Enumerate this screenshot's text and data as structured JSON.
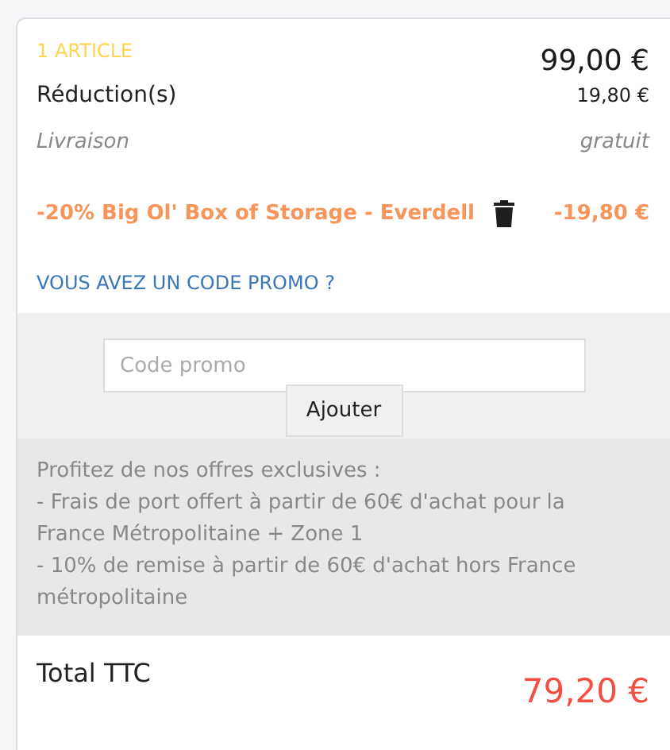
{
  "summary": {
    "items_label": "1 ARTICLE",
    "subtotal": "99,00 €",
    "rows": [
      {
        "label": "Réduction(s)",
        "value": "19,80 €",
        "kind": "plain"
      },
      {
        "label": "Livraison",
        "value": "gratuit",
        "kind": "muted"
      }
    ],
    "discount": {
      "label": "-20% Big Ol' Box of Storage - Everdell",
      "value": "-19,80 €"
    },
    "promo_link": "VOUS AVEZ UN CODE PROMO ?"
  },
  "promo": {
    "placeholder": "Code promo",
    "button": "Ajouter"
  },
  "offers": {
    "heading": "Profitez de nos offres exclusives :",
    "lines": [
      "- Frais de port offert à partir de 60€ d'achat pour la France Métropolitaine + Zone 1",
      "- 10% de remise à partir de 60€ d'achat hors France métropolitaine"
    ]
  },
  "total": {
    "label": "Total TTC",
    "value": "79,20 €"
  }
}
